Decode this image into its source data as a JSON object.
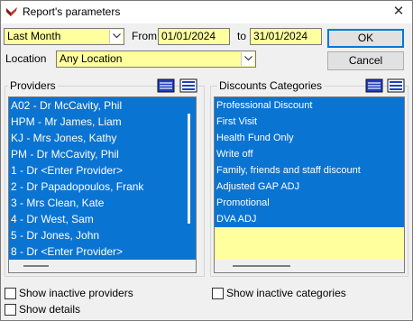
{
  "window": {
    "title": "Report's parameters",
    "close_glyph": "✕"
  },
  "period": {
    "selected": "Last Month",
    "from_label": "From",
    "from_value": "01/01/2024",
    "to_label": "to",
    "to_value": "31/01/2024"
  },
  "location": {
    "label": "Location",
    "selected": "Any Location"
  },
  "buttons": {
    "ok_label": "OK",
    "cancel_label": "Cancel"
  },
  "providers": {
    "title": "Providers",
    "items": [
      "A02 - Dr McCavity, Phil",
      "HPM - Mr James, Liam",
      "KJ - Mrs Jones, Kathy",
      "PM - Dr McCavity, Phil",
      "1 - Dr <Enter Provider>",
      "2 - Dr Papadopoulos, Frank",
      "3 - Mrs Clean, Kate",
      "4 - Dr West, Sam",
      "5 - Dr Jones, John",
      "8 - Dr <Enter Provider>"
    ],
    "show_inactive_label": "Show inactive providers",
    "show_details_label": "Show details"
  },
  "discounts": {
    "title": "Discounts Categories",
    "items": [
      "Professional Discount",
      "First Visit",
      "Health Fund Only",
      "Write off",
      "Family, friends and staff discount",
      "Adjusted GAP ADJ",
      "Promotional",
      "DVA ADJ"
    ],
    "show_inactive_label": "Show inactive categories"
  },
  "icons": {
    "app": "report-app-icon",
    "select_all": "select-all-icon",
    "deselect_all": "deselect-all-icon"
  },
  "colors": {
    "selection": "#0a74d2",
    "field_yellow": "#ffff9e",
    "default_button_border": "#0078d7"
  }
}
